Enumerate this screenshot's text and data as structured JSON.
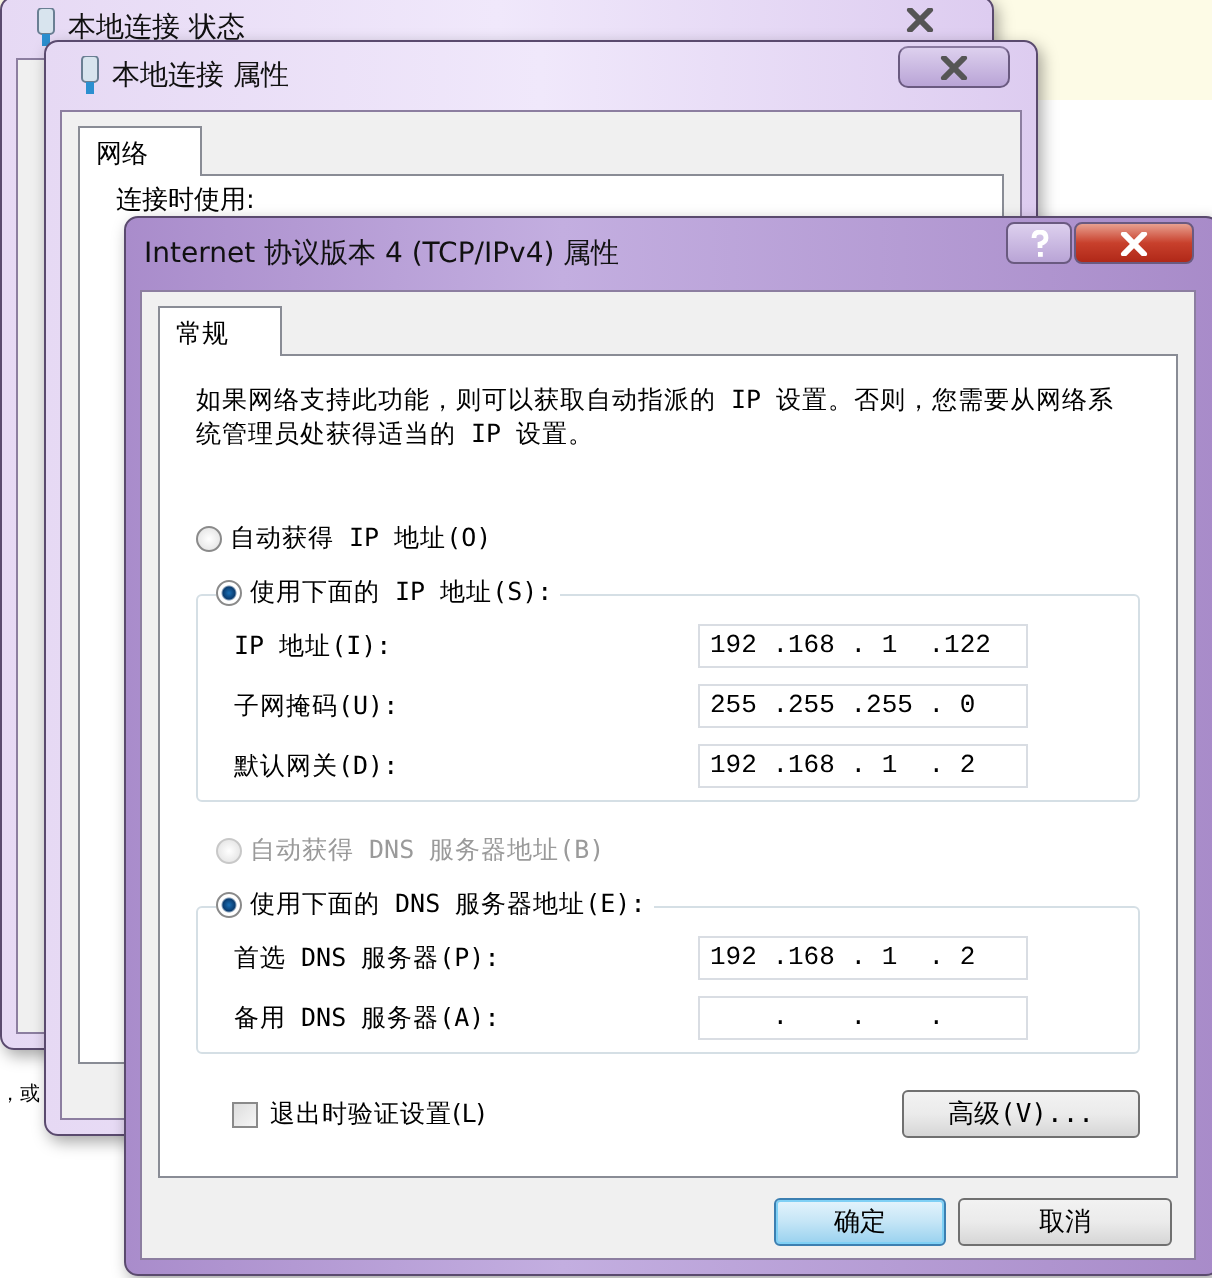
{
  "background_page": {
    "text": "，或"
  },
  "back_windows": [
    {
      "title": "本地连接 状态"
    },
    {
      "title": "本地连接 属性",
      "tabs": [
        {
          "label": "网络",
          "selected": true
        }
      ],
      "section_label": "连接时使用:"
    }
  ],
  "dialog": {
    "title": "Internet 协议版本 4 (TCP/IPv4) 属性",
    "tabs": [
      {
        "label": "常规",
        "selected": true
      }
    ],
    "intro": "如果网络支持此功能，则可以获取自动指派的 IP 设置。否则，您需要从网络系统管理员处获得适当的 IP 设置。",
    "ip_options": [
      {
        "label": "自动获得 IP 地址(O)",
        "selected": false,
        "disabled": false
      },
      {
        "label": "使用下面的 IP 地址(S):",
        "selected": true,
        "disabled": false
      }
    ],
    "ip_fields": [
      {
        "label": "IP 地址(I):",
        "value": "192 .168 . 1  .122"
      },
      {
        "label": "子网掩码(U):",
        "value": "255 .255 .255 . 0"
      },
      {
        "label": "默认网关(D):",
        "value": "192 .168 . 1  . 2"
      }
    ],
    "dns_options": [
      {
        "label": "自动获得 DNS 服务器地址(B)",
        "selected": false,
        "disabled": true
      },
      {
        "label": "使用下面的 DNS 服务器地址(E):",
        "selected": true,
        "disabled": false
      }
    ],
    "dns_fields": [
      {
        "label": "首选 DNS 服务器(P):",
        "value": "192 .168 . 1  . 2"
      },
      {
        "label": "备用 DNS 服务器(A):",
        "value": "    .    .    ."
      }
    ],
    "validate": {
      "label": "退出时验证设置(L)",
      "checked": false
    },
    "advanced_button": "高级(V)...",
    "buttons": [
      {
        "label": "确定",
        "default": true
      },
      {
        "label": "取消",
        "default": false
      }
    ]
  }
}
